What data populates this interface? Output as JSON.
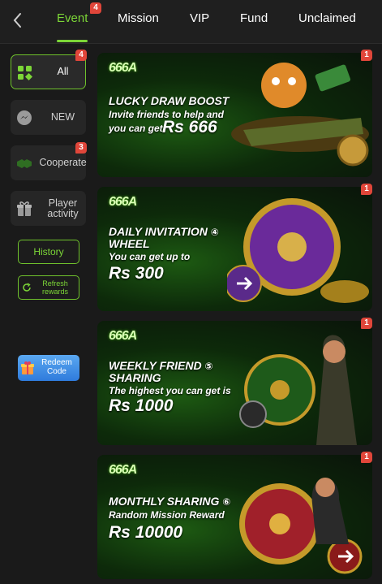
{
  "nav": {
    "tabs": [
      "Event",
      "Mission",
      "VIP",
      "Fund",
      "Unclaimed"
    ],
    "event_badge": "4"
  },
  "sidebar": {
    "categories": [
      {
        "label": "All",
        "badge": "4"
      },
      {
        "label": "NEW"
      },
      {
        "label": "Cooperate",
        "badge": "3"
      },
      {
        "label": "Player activity"
      }
    ],
    "history": "History",
    "refresh": "Refresh rewards",
    "redeem": "Redeem Code"
  },
  "banners": [
    {
      "logo": "666A",
      "title": "LUCKY DRAW BOOST",
      "sub": "Invite friends to help and",
      "sub2": "you can get",
      "amount": "Rs 666",
      "badge": "1"
    },
    {
      "logo": "666A",
      "title": "DAILY INVITATION",
      "title2": "WHEEL",
      "num": "④",
      "sub": "You can get up to",
      "amount": "Rs 300",
      "badge": "1"
    },
    {
      "logo": "666A",
      "title": "WEEKLY FRIEND",
      "num": "⑤",
      "title2": "SHARING",
      "sub": "The highest you can get is",
      "amount": "Rs 1000",
      "badge": "1"
    },
    {
      "logo": "666A",
      "title": "MONTHLY SHARING",
      "num": "⑥",
      "sub": "Random Mission Reward",
      "amount": "Rs 10000",
      "badge": "1"
    }
  ],
  "colors": {
    "accent": "#7cd637",
    "badge": "#e0463a",
    "bg": "#1a1a1a"
  }
}
